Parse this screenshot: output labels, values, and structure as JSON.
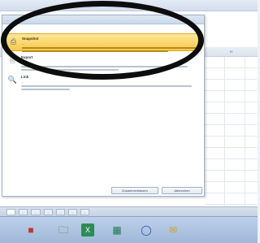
{
  "window": {
    "title": "..."
  },
  "sheet": {
    "columns": [
      "H"
    ]
  },
  "dialog": {
    "caption": "...",
    "options": [
      {
        "title": "Snapshot",
        "description": "...",
        "icon": "camera-icon",
        "selected": true
      },
      {
        "title": "Export",
        "description": "...",
        "icon": "document-icon",
        "selected": false
      },
      {
        "title": "Link",
        "description": "...",
        "icon": "search-icon",
        "selected": false
      }
    ],
    "buttons": {
      "primary": "Zusammenfassen",
      "secondary": "Abbrechen"
    }
  },
  "sheet_tabs": [
    "...",
    "...",
    "...",
    "...",
    "...",
    "...",
    "..."
  ],
  "taskbar": {
    "icons": [
      "start-icon",
      "folder-icon",
      "excel-icon",
      "chart-icon",
      "browser-icon",
      "mail-icon"
    ]
  },
  "colors": {
    "highlight": "#f7c948",
    "annotation": "#0d0d0d",
    "taskbar": "#9fb8d8"
  }
}
